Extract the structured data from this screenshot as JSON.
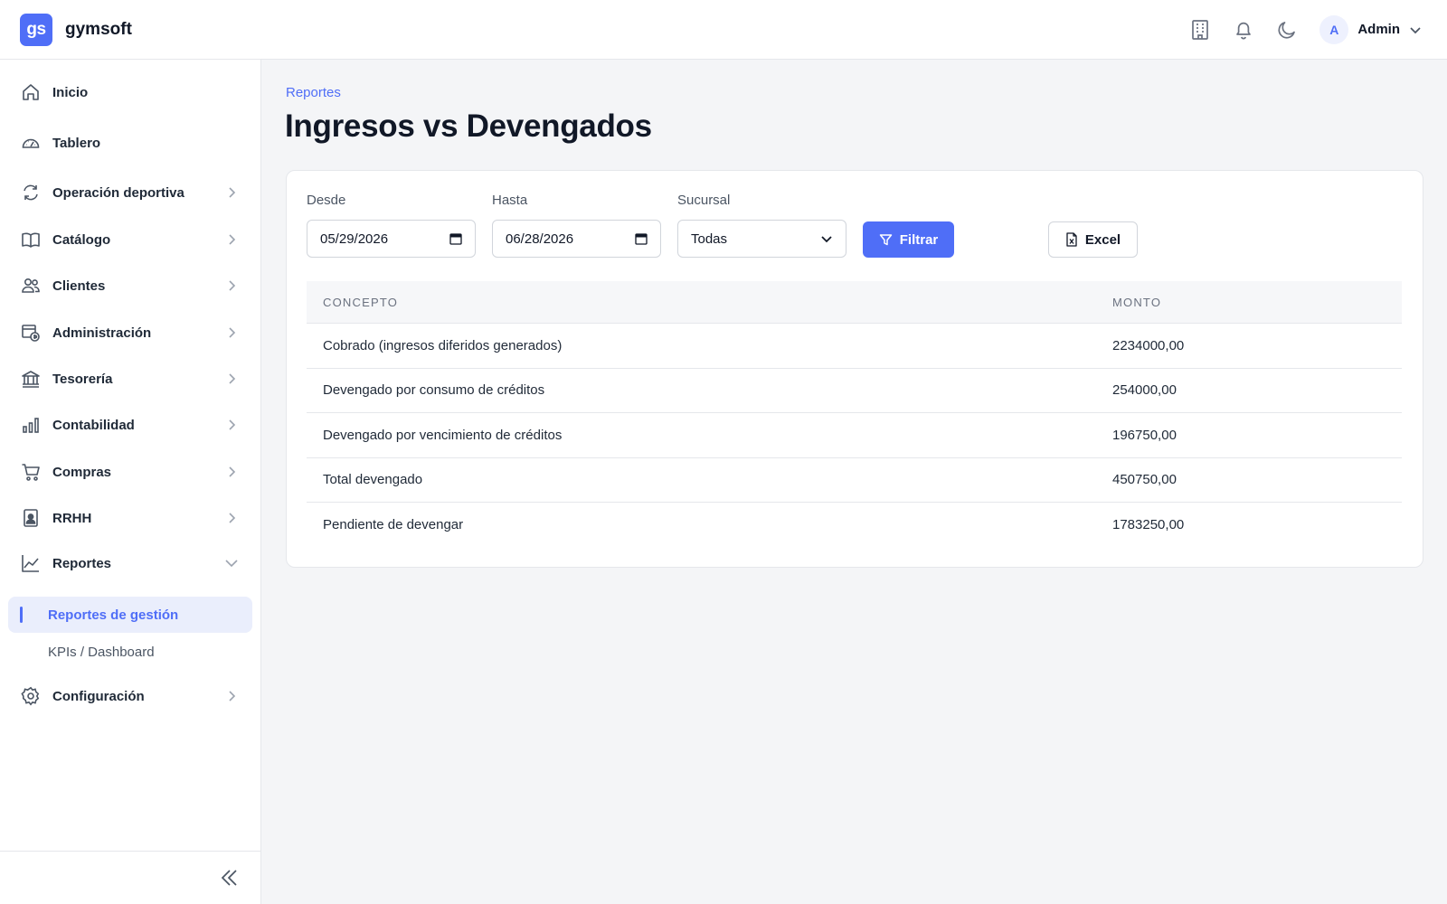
{
  "brand": {
    "logo": "gs",
    "name": "gymsoft",
    "accent": "#4f6ef7"
  },
  "header": {
    "icons": [
      "building-icon",
      "bell-icon",
      "moon-icon"
    ],
    "user": {
      "initial": "A",
      "name": "Admin"
    }
  },
  "sidebar": {
    "items": [
      {
        "label": "Inicio",
        "icon": "home-icon",
        "chevron": false
      },
      {
        "label": "Tablero",
        "icon": "gauge-icon",
        "chevron": true
      },
      {
        "label": "Operación deportiva",
        "icon": "refresh-icon",
        "chevron": true
      },
      {
        "label": "Catálogo",
        "icon": "book-icon",
        "chevron": true
      },
      {
        "label": "Clientes",
        "icon": "users-icon",
        "chevron": true
      },
      {
        "label": "Administración",
        "icon": "admin-icon",
        "chevron": true
      },
      {
        "label": "Tesorería",
        "icon": "bank-icon",
        "chevron": true
      },
      {
        "label": "Contabilidad",
        "icon": "bar-chart-icon",
        "chevron": true
      },
      {
        "label": "Compras",
        "icon": "cart-icon",
        "chevron": true
      },
      {
        "label": "RRHH",
        "icon": "badge-icon",
        "chevron": true
      },
      {
        "label": "Reportes",
        "icon": "line-chart-icon",
        "chevron": "down"
      },
      {
        "label": "Configuración",
        "icon": "gear-icon",
        "chevron": true
      }
    ],
    "subitems": [
      {
        "label": "Reportes de gestión",
        "active": true
      },
      {
        "label": "KPIs / Dashboard",
        "active": false
      }
    ]
  },
  "page": {
    "breadcrumb": "Reportes",
    "title": "Ingresos vs Devengados"
  },
  "filters": {
    "desde_label": "Desde",
    "desde_value": "05/29/2026",
    "hasta_label": "Hasta",
    "hasta_value": "06/28/2026",
    "sucursal_label": "Sucursal",
    "sucursal_value": "Todas",
    "filter_button": "Filtrar",
    "excel_button": "Excel"
  },
  "table": {
    "headers": [
      "CONCEPTO",
      "MONTO"
    ],
    "rows": [
      {
        "concepto": "Cobrado (ingresos diferidos generados)",
        "monto": "2234000,00"
      },
      {
        "concepto": "Devengado por consumo de créditos",
        "monto": "254000,00"
      },
      {
        "concepto": "Devengado por vencimiento de créditos",
        "monto": "196750,00"
      },
      {
        "concepto": "Total devengado",
        "monto": "450750,00"
      },
      {
        "concepto": "Pendiente de devengar",
        "monto": "1783250,00"
      }
    ]
  }
}
